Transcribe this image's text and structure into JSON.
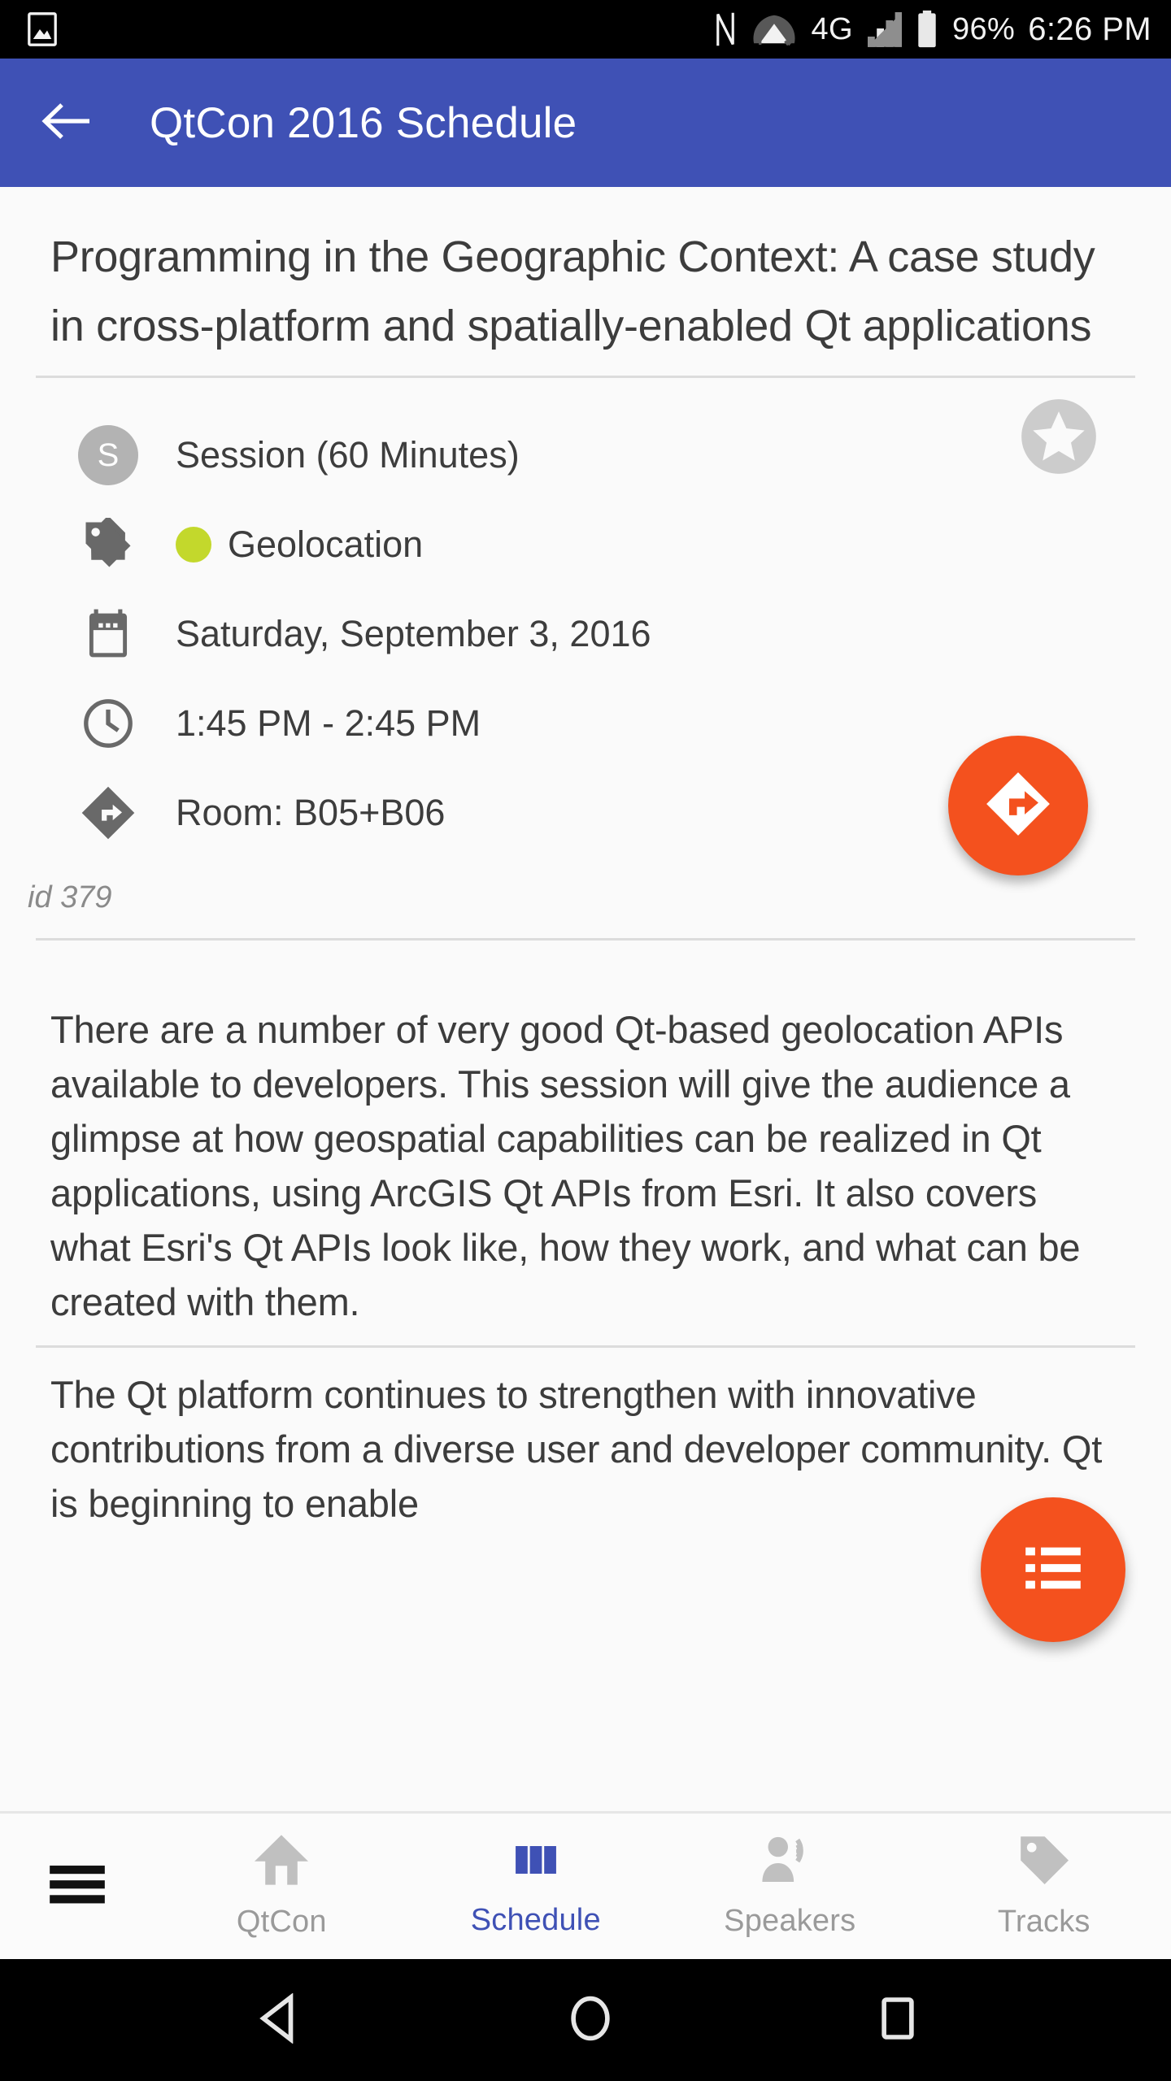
{
  "status_bar": {
    "icons_left": [
      "image-icon"
    ],
    "icons_right": [
      "nfc-icon",
      "wifi-icon",
      "signal-icon"
    ],
    "network": "4G",
    "battery": "96%",
    "time": "6:26 PM"
  },
  "app_bar": {
    "back_icon": "back-arrow-icon",
    "title": "QtCon 2016 Schedule",
    "color": "#3f51b5"
  },
  "session": {
    "title": "Programming in the Geographic Context: A case study in cross-platform and spatially-enabled Qt applications",
    "type": "Session (60 Minutes)",
    "type_badge": "S",
    "track": "Geolocation",
    "track_color": "#c3d82c",
    "date": "Saturday, September 3, 2016",
    "time": "1:45 PM - 2:45 PM",
    "room": "Room: B05+B06",
    "id": "id 379",
    "favorite_icon": "star-circle-icon",
    "favorite_active": false,
    "directions_fab_icon": "directions-icon",
    "fab_color": "#f4511e",
    "description": [
      "There are a number of very good Qt-based geolocation APIs available to developers. This session will give the audience a glimpse at how geospatial capabilities can be realized in Qt applications, using ArcGIS Qt APIs from Esri. It also covers what Esri's Qt APIs look like, how they work, and what can be created with them.",
      "The Qt platform continues to strengthen with innovative contributions from a diverse user and developer community. Qt is beginning to enable"
    ]
  },
  "list_fab": {
    "icon": "list-icon"
  },
  "bottom_nav": {
    "menu_icon": "hamburger-menu-icon",
    "active_index": 1,
    "items": [
      {
        "label": "QtCon",
        "icon": "home-icon"
      },
      {
        "label": "Schedule",
        "icon": "schedule-bars-icon"
      },
      {
        "label": "Speakers",
        "icon": "speaker-person-icon"
      },
      {
        "label": "Tracks",
        "icon": "tag-icon"
      }
    ]
  },
  "android_nav": {
    "back": "nav-back-triangle-icon",
    "home": "nav-home-circle-icon",
    "recents": "nav-recents-square-icon"
  }
}
